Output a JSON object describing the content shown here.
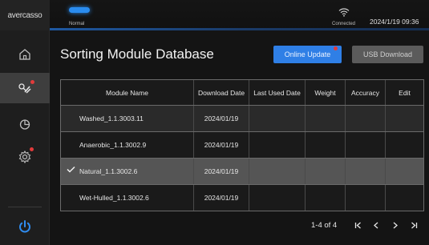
{
  "brand": "avercasso",
  "status": {
    "mode_label": "Normal",
    "connection_label": "Connected",
    "datetime": "2024/1/19 09:36"
  },
  "page": {
    "title": "Sorting Module Database",
    "online_update_label": "Online Update",
    "usb_download_label": "USB Download"
  },
  "sidebar": {
    "items": [
      {
        "icon": "home-icon",
        "active": false
      },
      {
        "icon": "sorting-module-icon",
        "active": true,
        "badge": true
      },
      {
        "icon": "statistics-pie-icon",
        "active": false
      },
      {
        "icon": "settings-gear-icon",
        "active": false,
        "badge": true
      }
    ],
    "power_icon": "power-icon"
  },
  "table": {
    "headers": [
      "Module Name",
      "Download Date",
      "Last Used Date",
      "Weight",
      "Accuracy",
      "Edit"
    ],
    "rows": [
      {
        "name": "Washed_1.1.3003.11",
        "download_date": "2024/01/19",
        "last_used": "",
        "weight": "",
        "accuracy": "",
        "edit": "",
        "selected": false,
        "striped": true
      },
      {
        "name": "Anaerobic_1.1.3002.9",
        "download_date": "2024/01/19",
        "last_used": "",
        "weight": "",
        "accuracy": "",
        "edit": "",
        "selected": false,
        "striped": false
      },
      {
        "name": "Natural_1.1.3002.6",
        "download_date": "2024/01/19",
        "last_used": "",
        "weight": "",
        "accuracy": "",
        "edit": "",
        "selected": true,
        "striped": true
      },
      {
        "name": "Wet-Hulled_1.1.3002.6",
        "download_date": "2024/01/19",
        "last_used": "",
        "weight": "",
        "accuracy": "",
        "edit": "",
        "selected": false,
        "striped": false
      }
    ]
  },
  "pagination": {
    "range": "1-4 of 4",
    "first": "|<",
    "prev": "<",
    "next": ">",
    "last": ">|"
  },
  "colors": {
    "accent": "#2f7fe6",
    "badge": "#e23b3b",
    "selected_row": "#555555",
    "striped_row": "#2a2a2a"
  }
}
